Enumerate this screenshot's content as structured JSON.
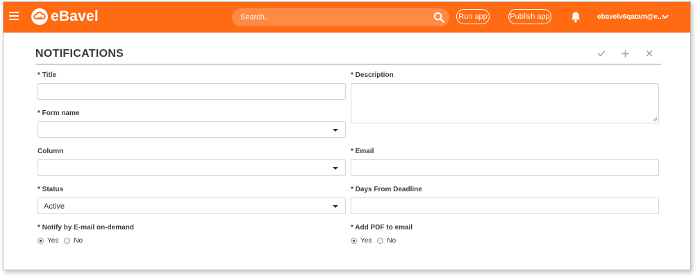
{
  "header": {
    "app_name": "eBavel",
    "search_placeholder": "Search..",
    "run_app": "Run app",
    "publish_app": "Publish app",
    "user": "ebavelv6qatam@e..."
  },
  "page": {
    "title": "NOTIFICATIONS"
  },
  "form": {
    "title_label": "* Title",
    "description_label": "* Description",
    "form_name_label": "* Form name",
    "column_label": "Column",
    "email_label": "* Email",
    "status_label": "* Status",
    "status_value": "Active",
    "days_label": "* Days From Deadline",
    "notify_label": "* Notify by E-mail on-demand",
    "pdf_label": "* Add PDF to email",
    "yes": "Yes",
    "no": "No",
    "notify_selected": "Yes",
    "pdf_selected": "Yes"
  },
  "colors": {
    "brand": "#ff6a13",
    "text": "#3b3b3b"
  }
}
